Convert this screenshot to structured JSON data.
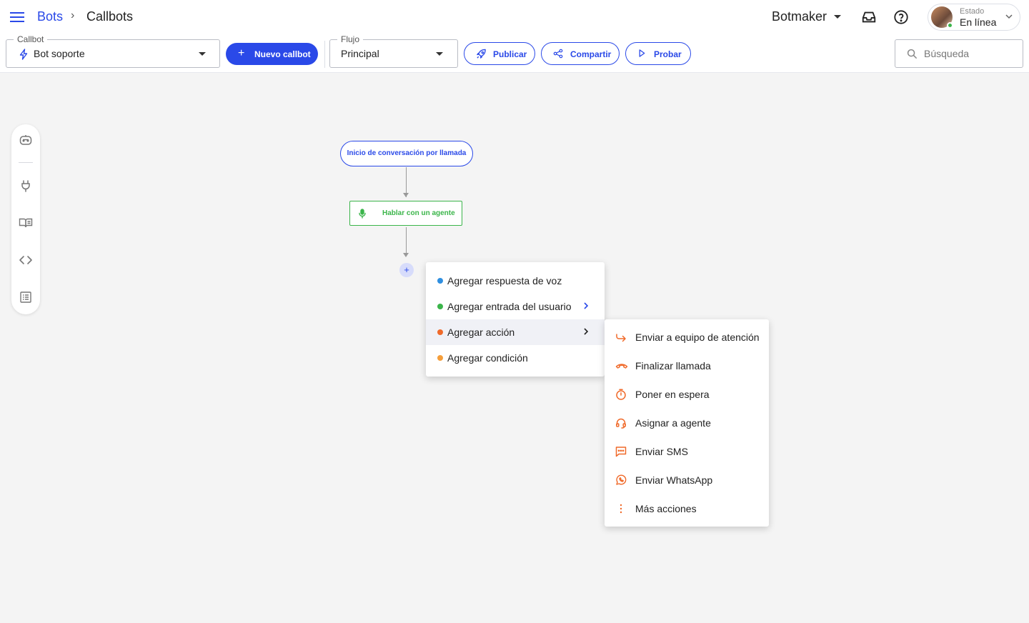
{
  "breadcrumb": {
    "root": "Bots",
    "separator": "›",
    "current": "Callbots"
  },
  "header": {
    "org_name": "Botmaker",
    "status_label": "Estado",
    "status_value": "En línea"
  },
  "toolbar": {
    "callbot_label": "Callbot",
    "callbot_value": "Bot soporte",
    "new_callbot_label": "Nuevo callbot",
    "flow_label": "Flujo",
    "flow_value": "Principal",
    "publish_label": "Publicar",
    "share_label": "Compartir",
    "test_label": "Probar",
    "search_placeholder": "Búsqueda"
  },
  "side_toolbar": {
    "icons": [
      "bot-icon",
      "plug-icon",
      "book-icon",
      "code-icon",
      "list-icon"
    ]
  },
  "canvas": {
    "start_node": "Inicio de conversación por llamada",
    "agent_node": "Hablar con un agente",
    "add_symbol": "+"
  },
  "menu": {
    "items": [
      {
        "label": "Agregar respuesta de voz",
        "color": "#2f8fe0"
      },
      {
        "label": "Agregar entrada del usuario",
        "color": "#3bb54a"
      },
      {
        "label": "Agregar acción",
        "color": "#f06a2a"
      },
      {
        "label": "Agregar condición",
        "color": "#f59e3b"
      }
    ]
  },
  "submenu": {
    "items": [
      {
        "label": "Enviar a equipo de atención",
        "icon": "forward-icon"
      },
      {
        "label": "Finalizar llamada",
        "icon": "hangup-icon"
      },
      {
        "label": "Poner en espera",
        "icon": "timer-icon"
      },
      {
        "label": "Asignar a agente",
        "icon": "headset-icon"
      },
      {
        "label": "Enviar SMS",
        "icon": "sms-icon"
      },
      {
        "label": "Enviar WhatsApp",
        "icon": "whatsapp-icon"
      },
      {
        "label": "Más acciones",
        "icon": "more-vertical-icon"
      }
    ]
  },
  "colors": {
    "primary": "#2a49e8",
    "green": "#3bb54a",
    "orange": "#f06a2a"
  }
}
